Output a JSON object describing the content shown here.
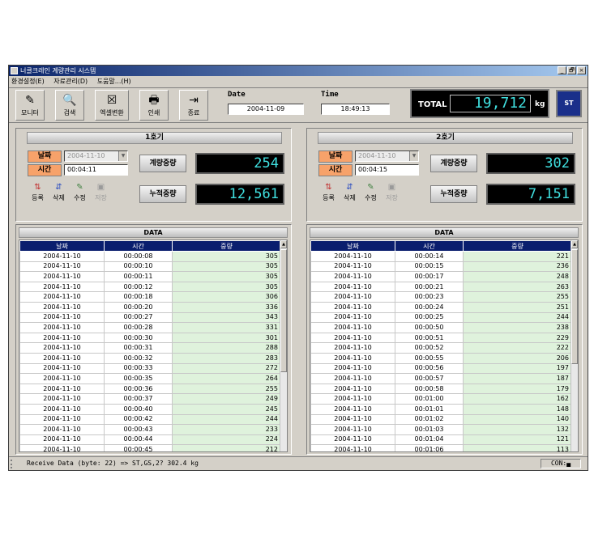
{
  "window": {
    "title": "너클크레인 계량관리 시스템",
    "controls": [
      "_",
      "🗗",
      "×"
    ]
  },
  "menu": [
    "환경설정(E)",
    "자료관리(D)",
    "도움말...(H)"
  ],
  "toolbar": [
    {
      "label": "모니터",
      "icon": "monitor-icon",
      "glyph": "✎"
    },
    {
      "label": "검색",
      "icon": "search-icon",
      "glyph": "🔍"
    },
    {
      "label": "엑셀변환",
      "icon": "excel-icon",
      "glyph": "☒"
    },
    {
      "label": "인쇄",
      "icon": "print-icon",
      "glyph": "🖶"
    },
    {
      "label": "종료",
      "icon": "exit-icon",
      "glyph": "⇥"
    }
  ],
  "date": {
    "label": "Date",
    "value": "2004-11-09"
  },
  "time": {
    "label": "Time",
    "value": "18:49:13"
  },
  "total": {
    "label": "TOTAL",
    "value": "19,712",
    "unit": "kg"
  },
  "logo": {
    "text": "ST"
  },
  "units": [
    {
      "title": "1호기",
      "date_label": "날짜",
      "date_value": "2004-11-10",
      "time_label": "시간",
      "time_value": "00:04:11",
      "weigh_label": "계량중량",
      "weigh_value": "254",
      "cum_label": "누적중량",
      "cum_value": "12,561",
      "actions": [
        "등록",
        "삭제",
        "수정",
        "저장"
      ]
    },
    {
      "title": "2호기",
      "date_label": "날짜",
      "date_value": "2004-11-10",
      "time_label": "시간",
      "time_value": "00:04:15",
      "weigh_label": "계량중량",
      "weigh_value": "302",
      "cum_label": "누적중량",
      "cum_value": "7,151",
      "actions": [
        "등록",
        "삭제",
        "수정",
        "저장"
      ]
    }
  ],
  "data_tables": [
    {
      "title": "DATA",
      "columns": [
        "날짜",
        "시간",
        "중량"
      ],
      "rows": [
        [
          "2004-11-10",
          "00:00:08",
          "305"
        ],
        [
          "2004-11-10",
          "00:00:10",
          "305"
        ],
        [
          "2004-11-10",
          "00:00:11",
          "305"
        ],
        [
          "2004-11-10",
          "00:00:12",
          "305"
        ],
        [
          "2004-11-10",
          "00:00:18",
          "306"
        ],
        [
          "2004-11-10",
          "00:00:20",
          "336"
        ],
        [
          "2004-11-10",
          "00:00:27",
          "343"
        ],
        [
          "2004-11-10",
          "00:00:28",
          "331"
        ],
        [
          "2004-11-10",
          "00:00:30",
          "301"
        ],
        [
          "2004-11-10",
          "00:00:31",
          "288"
        ],
        [
          "2004-11-10",
          "00:00:32",
          "283"
        ],
        [
          "2004-11-10",
          "00:00:33",
          "272"
        ],
        [
          "2004-11-10",
          "00:00:35",
          "264"
        ],
        [
          "2004-11-10",
          "00:00:36",
          "255"
        ],
        [
          "2004-11-10",
          "00:00:37",
          "249"
        ],
        [
          "2004-11-10",
          "00:00:40",
          "245"
        ],
        [
          "2004-11-10",
          "00:00:42",
          "244"
        ],
        [
          "2004-11-10",
          "00:00:43",
          "233"
        ],
        [
          "2004-11-10",
          "00:00:44",
          "224"
        ],
        [
          "2004-11-10",
          "00:00:45",
          "212"
        ]
      ]
    },
    {
      "title": "DATA",
      "columns": [
        "날짜",
        "시간",
        "중량"
      ],
      "rows": [
        [
          "2004-11-10",
          "00:00:14",
          "221"
        ],
        [
          "2004-11-10",
          "00:00:15",
          "236"
        ],
        [
          "2004-11-10",
          "00:00:17",
          "248"
        ],
        [
          "2004-11-10",
          "00:00:21",
          "263"
        ],
        [
          "2004-11-10",
          "00:00:23",
          "255"
        ],
        [
          "2004-11-10",
          "00:00:24",
          "251"
        ],
        [
          "2004-11-10",
          "00:00:25",
          "244"
        ],
        [
          "2004-11-10",
          "00:00:50",
          "238"
        ],
        [
          "2004-11-10",
          "00:00:51",
          "229"
        ],
        [
          "2004-11-10",
          "00:00:52",
          "222"
        ],
        [
          "2004-11-10",
          "00:00:55",
          "206"
        ],
        [
          "2004-11-10",
          "00:00:56",
          "197"
        ],
        [
          "2004-11-10",
          "00:00:57",
          "187"
        ],
        [
          "2004-11-10",
          "00:00:58",
          "179"
        ],
        [
          "2004-11-10",
          "00:01:00",
          "162"
        ],
        [
          "2004-11-10",
          "00:01:01",
          "148"
        ],
        [
          "2004-11-10",
          "00:01:02",
          "140"
        ],
        [
          "2004-11-10",
          "00:01:03",
          "132"
        ],
        [
          "2004-11-10",
          "00:01:04",
          "121"
        ],
        [
          "2004-11-10",
          "00:01:06",
          "113"
        ]
      ]
    }
  ],
  "status": {
    "text": "Receive Data (byte: 22) => ST,GS,2?    302.4 kg",
    "con": "CON:▄"
  }
}
